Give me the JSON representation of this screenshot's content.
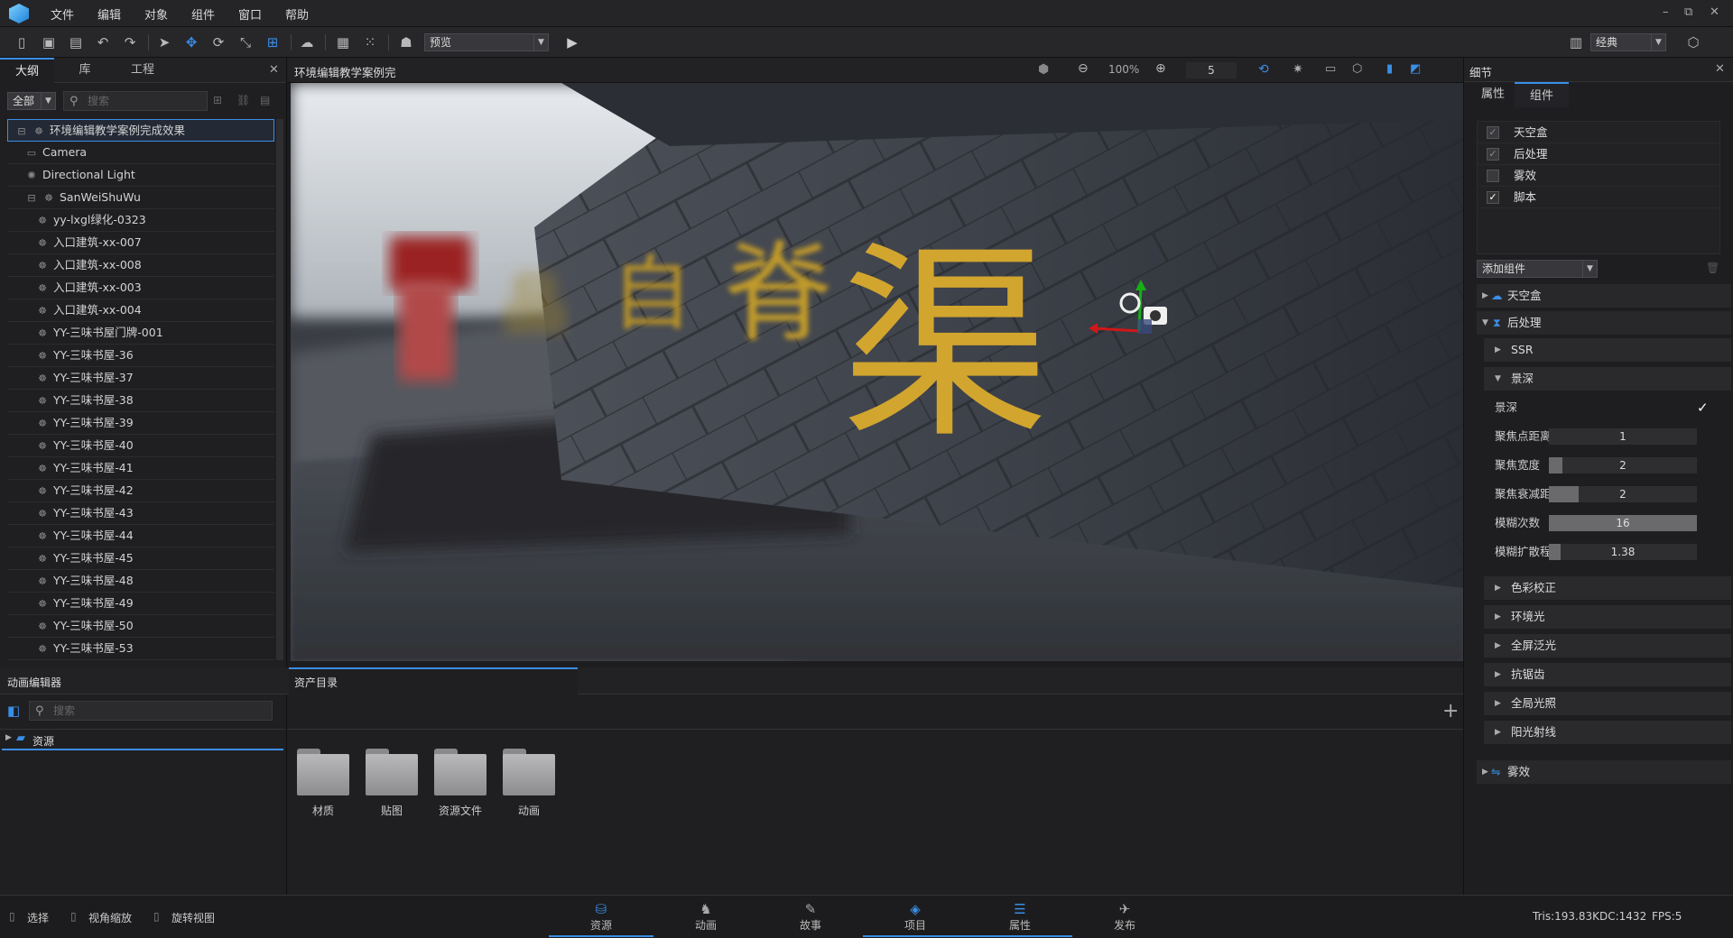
{
  "menu": {
    "items": [
      "文件",
      "编辑",
      "对象",
      "组件",
      "窗口",
      "帮助"
    ]
  },
  "window_controls": {
    "minimize": "–",
    "restore": "⧉",
    "close": "✕"
  },
  "toolbar": {
    "preview_label": "预览",
    "layout_label": "经典"
  },
  "outline": {
    "tabs": [
      "大纲",
      "库",
      "工程"
    ],
    "filter": "全部",
    "search_placeholder": "搜索",
    "items": [
      {
        "label": "环境编辑教学案例完成效果",
        "icon": "group-icon",
        "depth": 0,
        "selected": true
      },
      {
        "label": "Camera",
        "icon": "camera-icon",
        "depth": 1
      },
      {
        "label": "Directional Light",
        "icon": "light-icon",
        "depth": 1
      },
      {
        "label": "SanWeiShuWu",
        "icon": "group-icon",
        "depth": 1
      },
      {
        "label": "yy-lxgl绿化-0323",
        "icon": "model-icon",
        "depth": 2
      },
      {
        "label": "入口建筑-xx-007",
        "icon": "model-icon",
        "depth": 2
      },
      {
        "label": "入口建筑-xx-008",
        "icon": "model-icon",
        "depth": 2
      },
      {
        "label": "入口建筑-xx-003",
        "icon": "model-icon",
        "depth": 2
      },
      {
        "label": "入口建筑-xx-004",
        "icon": "model-icon",
        "depth": 2
      },
      {
        "label": "YY-三味书屋门牌-001",
        "icon": "model-icon",
        "depth": 2
      },
      {
        "label": "YY-三味书屋-36",
        "icon": "model-icon",
        "depth": 2
      },
      {
        "label": "YY-三味书屋-37",
        "icon": "model-icon",
        "depth": 2
      },
      {
        "label": "YY-三味书屋-38",
        "icon": "model-icon",
        "depth": 2
      },
      {
        "label": "YY-三味书屋-39",
        "icon": "model-icon",
        "depth": 2
      },
      {
        "label": "YY-三味书屋-40",
        "icon": "model-icon",
        "depth": 2
      },
      {
        "label": "YY-三味书屋-41",
        "icon": "model-icon",
        "depth": 2
      },
      {
        "label": "YY-三味书屋-42",
        "icon": "model-icon",
        "depth": 2
      },
      {
        "label": "YY-三味书屋-43",
        "icon": "model-icon",
        "depth": 2
      },
      {
        "label": "YY-三味书屋-44",
        "icon": "model-icon",
        "depth": 2
      },
      {
        "label": "YY-三味书屋-45",
        "icon": "model-icon",
        "depth": 2
      },
      {
        "label": "YY-三味书屋-48",
        "icon": "model-icon",
        "depth": 2
      },
      {
        "label": "YY-三味书屋-49",
        "icon": "model-icon",
        "depth": 2
      },
      {
        "label": "YY-三味书屋-50",
        "icon": "model-icon",
        "depth": 2
      },
      {
        "label": "YY-三味书屋-53",
        "icon": "model-icon",
        "depth": 2
      }
    ]
  },
  "viewport": {
    "title": "环境编辑教学案例完",
    "zoom": "100%",
    "speed": "5",
    "sign_chars": [
      "渠",
      "脊",
      "自",
      "品"
    ]
  },
  "details": {
    "title": "细节",
    "tabs": [
      "属性",
      "组件"
    ],
    "components": [
      {
        "label": "天空盒",
        "checked": true
      },
      {
        "label": "后处理",
        "checked": true
      },
      {
        "label": "雾效",
        "checked": false
      },
      {
        "label": "脚本",
        "checked": true
      }
    ],
    "add_component": "添加组件",
    "sections": {
      "skybox": "天空盒",
      "post": "后处理",
      "fog": "雾效"
    },
    "post_subsections": {
      "ssr": "SSR",
      "dof": "景深",
      "color": "色彩校正",
      "ao": "环境光",
      "bloom": "全屏泛光",
      "aa": "抗锯齿",
      "gi": "全局光照",
      "sunrays": "阳光射线"
    },
    "dof_props": [
      {
        "label": "景深",
        "value": "✓",
        "fill": 0
      },
      {
        "label": "聚焦点距离",
        "value": "1",
        "fill": 0
      },
      {
        "label": "聚焦宽度",
        "value": "2",
        "fill": 0.09
      },
      {
        "label": "聚焦衰减距离",
        "value": "2",
        "fill": 0.2
      },
      {
        "label": "模糊次数",
        "value": "16",
        "fill": 1.0
      },
      {
        "label": "模糊扩散程度",
        "value": "1.38",
        "fill": 0.08
      }
    ]
  },
  "anim_editor": {
    "title": "动画编辑器",
    "search_placeholder": "搜索",
    "root": "资源"
  },
  "assets": {
    "tab": "资产目录",
    "folders": [
      "材质",
      "贴图",
      "资源文件",
      "动画"
    ]
  },
  "status": {
    "tools": [
      "选择",
      "视角缩放",
      "旋转视图"
    ],
    "nav": [
      {
        "label": "资源",
        "icon": "assets-icon",
        "active": true
      },
      {
        "label": "动画",
        "icon": "animation-icon",
        "active": false
      },
      {
        "label": "故事",
        "icon": "story-icon",
        "active": false
      },
      {
        "label": "项目",
        "icon": "project-icon",
        "active": true
      },
      {
        "label": "属性",
        "icon": "properties-icon",
        "active": true
      },
      {
        "label": "发布",
        "icon": "publish-icon",
        "active": false
      }
    ],
    "tris": "Tris:193.83K",
    "dc": "DC:1432",
    "fps": "FPS:5"
  }
}
